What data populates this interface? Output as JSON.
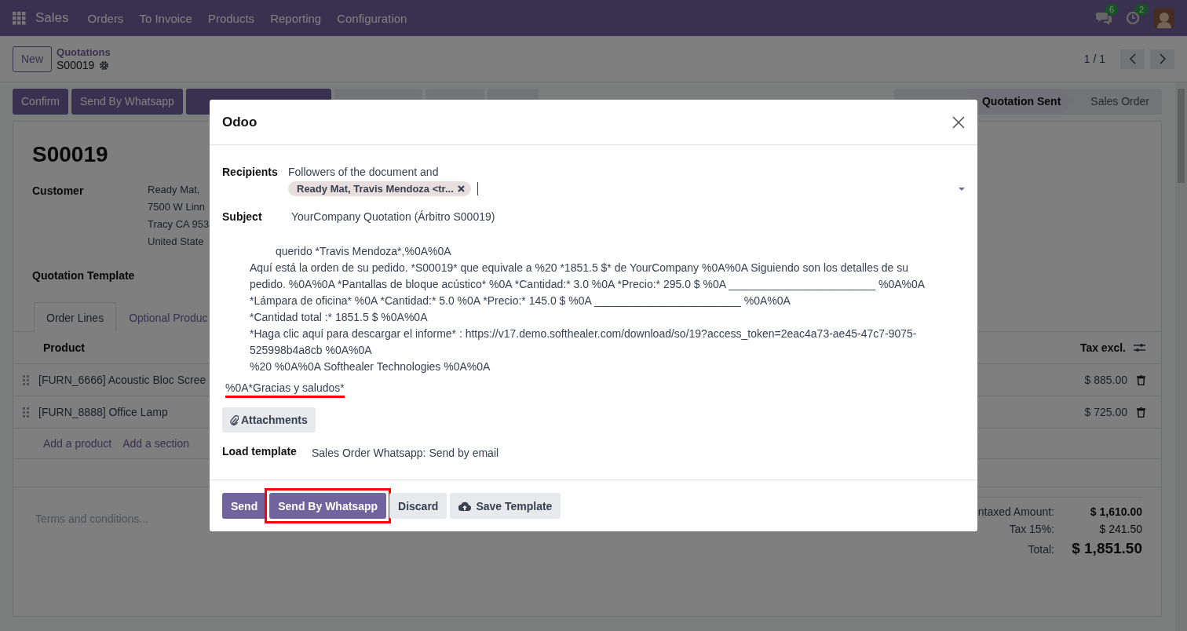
{
  "navbar": {
    "app": "Sales",
    "menu": [
      "Orders",
      "To Invoice",
      "Products",
      "Reporting",
      "Configuration"
    ],
    "badges": [
      {
        "kind": "chat",
        "count": "6"
      },
      {
        "kind": "activity",
        "count": "2"
      }
    ]
  },
  "control_panel": {
    "new_button": "New",
    "breadcrumb_parent": "Quotations",
    "breadcrumb_current": "S00019",
    "pager": "1 / 1"
  },
  "actions": [
    {
      "label": "Confirm",
      "kind": "primary"
    },
    {
      "label": "Send By Whatsapp",
      "kind": "primary"
    },
    {
      "kind": "primary"
    },
    {
      "kind": "secondary"
    },
    {
      "kind": "secondary"
    },
    {
      "kind": "secondary"
    }
  ],
  "statusbar": [
    {
      "label": "Quotation Sent",
      "selected": true
    },
    {
      "label": "Sales Order",
      "selected": false
    }
  ],
  "form": {
    "title": "S00019",
    "customer_label": "Customer",
    "customer_lines": [
      "Ready Mat,",
      "7500 W Linn",
      "Tracy CA 953",
      "United State"
    ],
    "template_label": "Quotation Template",
    "tabs": [
      {
        "label": "Order Lines",
        "selected": true
      },
      {
        "label": "Optional Produc",
        "selected": false
      }
    ],
    "columns": [
      "Product",
      "Tax excl."
    ],
    "rows": [
      {
        "product": "[FURN_6666] Acoustic Bloc Scree",
        "amount": "$ 885.00"
      },
      {
        "product": "[FURN_8888] Office Lamp",
        "amount": "$ 725.00"
      }
    ],
    "add_links": [
      "Add a product",
      "Add a section"
    ],
    "terms_placeholder": "Terms and conditions...",
    "totals": [
      {
        "kind": "subtotal",
        "label": "ntaxed Amount:",
        "value": "$ 1,610.00"
      },
      {
        "kind": "tax",
        "label": "Tax 15%:",
        "value": "$ 241.50"
      },
      {
        "kind": "total",
        "label": "Total:",
        "value": "$ 1,851.50"
      }
    ]
  },
  "dialog": {
    "title": "Odoo",
    "recipients_label": "Recipients",
    "recipients_intro": "Followers of the document and",
    "recipient_tag": "Ready Mat, Travis Mendoza <tr...",
    "subject_label": "Subject",
    "subject": "YourCompany Quotation (Árbitro S00019)",
    "body_lines": [
      {
        "text": "querido *Travis Mendoza*,%0A%0A",
        "indented": true
      },
      {
        "text": "Aquí está la orden de su pedido. *S00019* que equivale a %20 *1851.5 $* de YourCompany %0A%0A Siguiendo son los detalles de su",
        "indented": false
      },
      {
        "text": "pedido. %0A%0A *Pantallas de bloque acústico* %0A *Cantidad:* 3.0 %0A *Precio:* 295.0 $ %0A ________________________ %0A%0A",
        "indented": false
      },
      {
        "text": "*Lámpara de oficina* %0A *Cantidad:* 5.0 %0A *Precio:* 145.0 $ %0A ________________________ %0A%0A",
        "indented": false
      },
      {
        "text": "*Cantidad total :* 1851.5 $ %0A%0A",
        "indented": false
      },
      {
        "text": "*Haga clic aquí para descargar el informe* : https://v17.demo.softhealer.com/download/so/19?access_token=2eac4a73-ae45-47c7-9075-",
        "indented": false
      },
      {
        "text": "525998b4a8cb %0A%0A",
        "indented": false
      },
      {
        "text": "%20 %0A%0A Softhealer Technologies %0A%0A",
        "indented": false
      }
    ],
    "closing_line": {
      "text": "%0A*Gracias y saludos*",
      "highlighted": true
    },
    "attachments_button": "Attachments",
    "template_label": "Load template",
    "template_value": "Sales Order Whatsapp: Send by email",
    "buttons": [
      {
        "label": "Send",
        "kind": "primary",
        "highlighted": false
      },
      {
        "label": "Send By Whatsapp",
        "kind": "primary",
        "highlighted": true
      },
      {
        "label": "Discard",
        "kind": "secondary",
        "highlighted": false
      },
      {
        "label": "Save Template",
        "kind": "secondary",
        "highlighted": false
      }
    ]
  }
}
